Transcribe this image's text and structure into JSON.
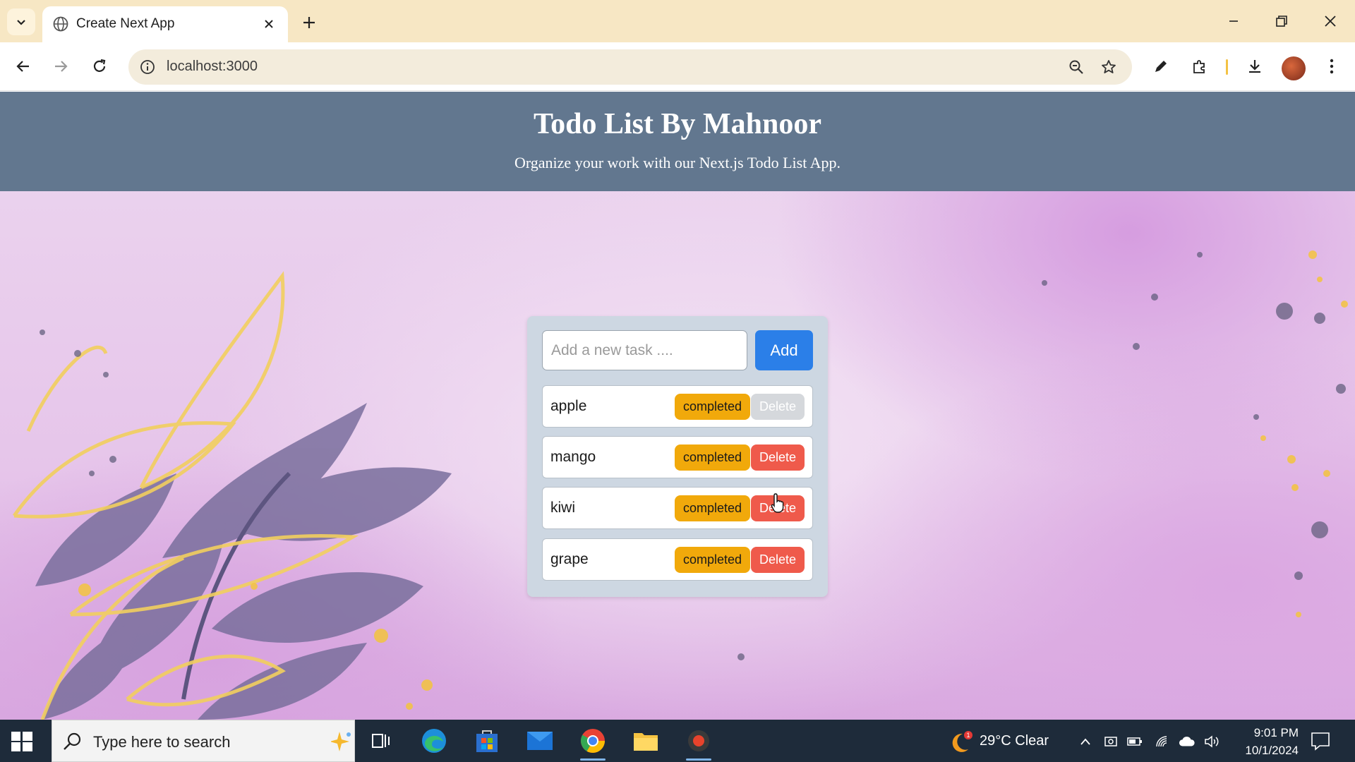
{
  "browser": {
    "tab_title": "Create Next App",
    "url": "localhost:3000"
  },
  "app": {
    "title": "Todo List By Mahnoor",
    "subtitle": "Organize your work with our Next.js Todo List App.",
    "input_placeholder": "Add a new task ....",
    "add_label": "Add",
    "todos": [
      {
        "text": "apple",
        "status_label": "completed",
        "delete_label": "Delete"
      },
      {
        "text": "mango",
        "status_label": "completed",
        "delete_label": "Delete"
      },
      {
        "text": "kiwi",
        "status_label": "completed",
        "delete_label": "Delete"
      },
      {
        "text": "grape",
        "status_label": "completed",
        "delete_label": "Delete"
      }
    ],
    "colors": {
      "header": "#62778f",
      "add_button": "#2b7fe8",
      "completed_button": "#f1a90b",
      "delete_button": "#ef5a4b"
    }
  },
  "taskbar": {
    "search_placeholder": "Type here to search",
    "weather": "29°C  Clear",
    "weather_badge": "1",
    "time": "9:01 PM",
    "date": "10/1/2024"
  }
}
